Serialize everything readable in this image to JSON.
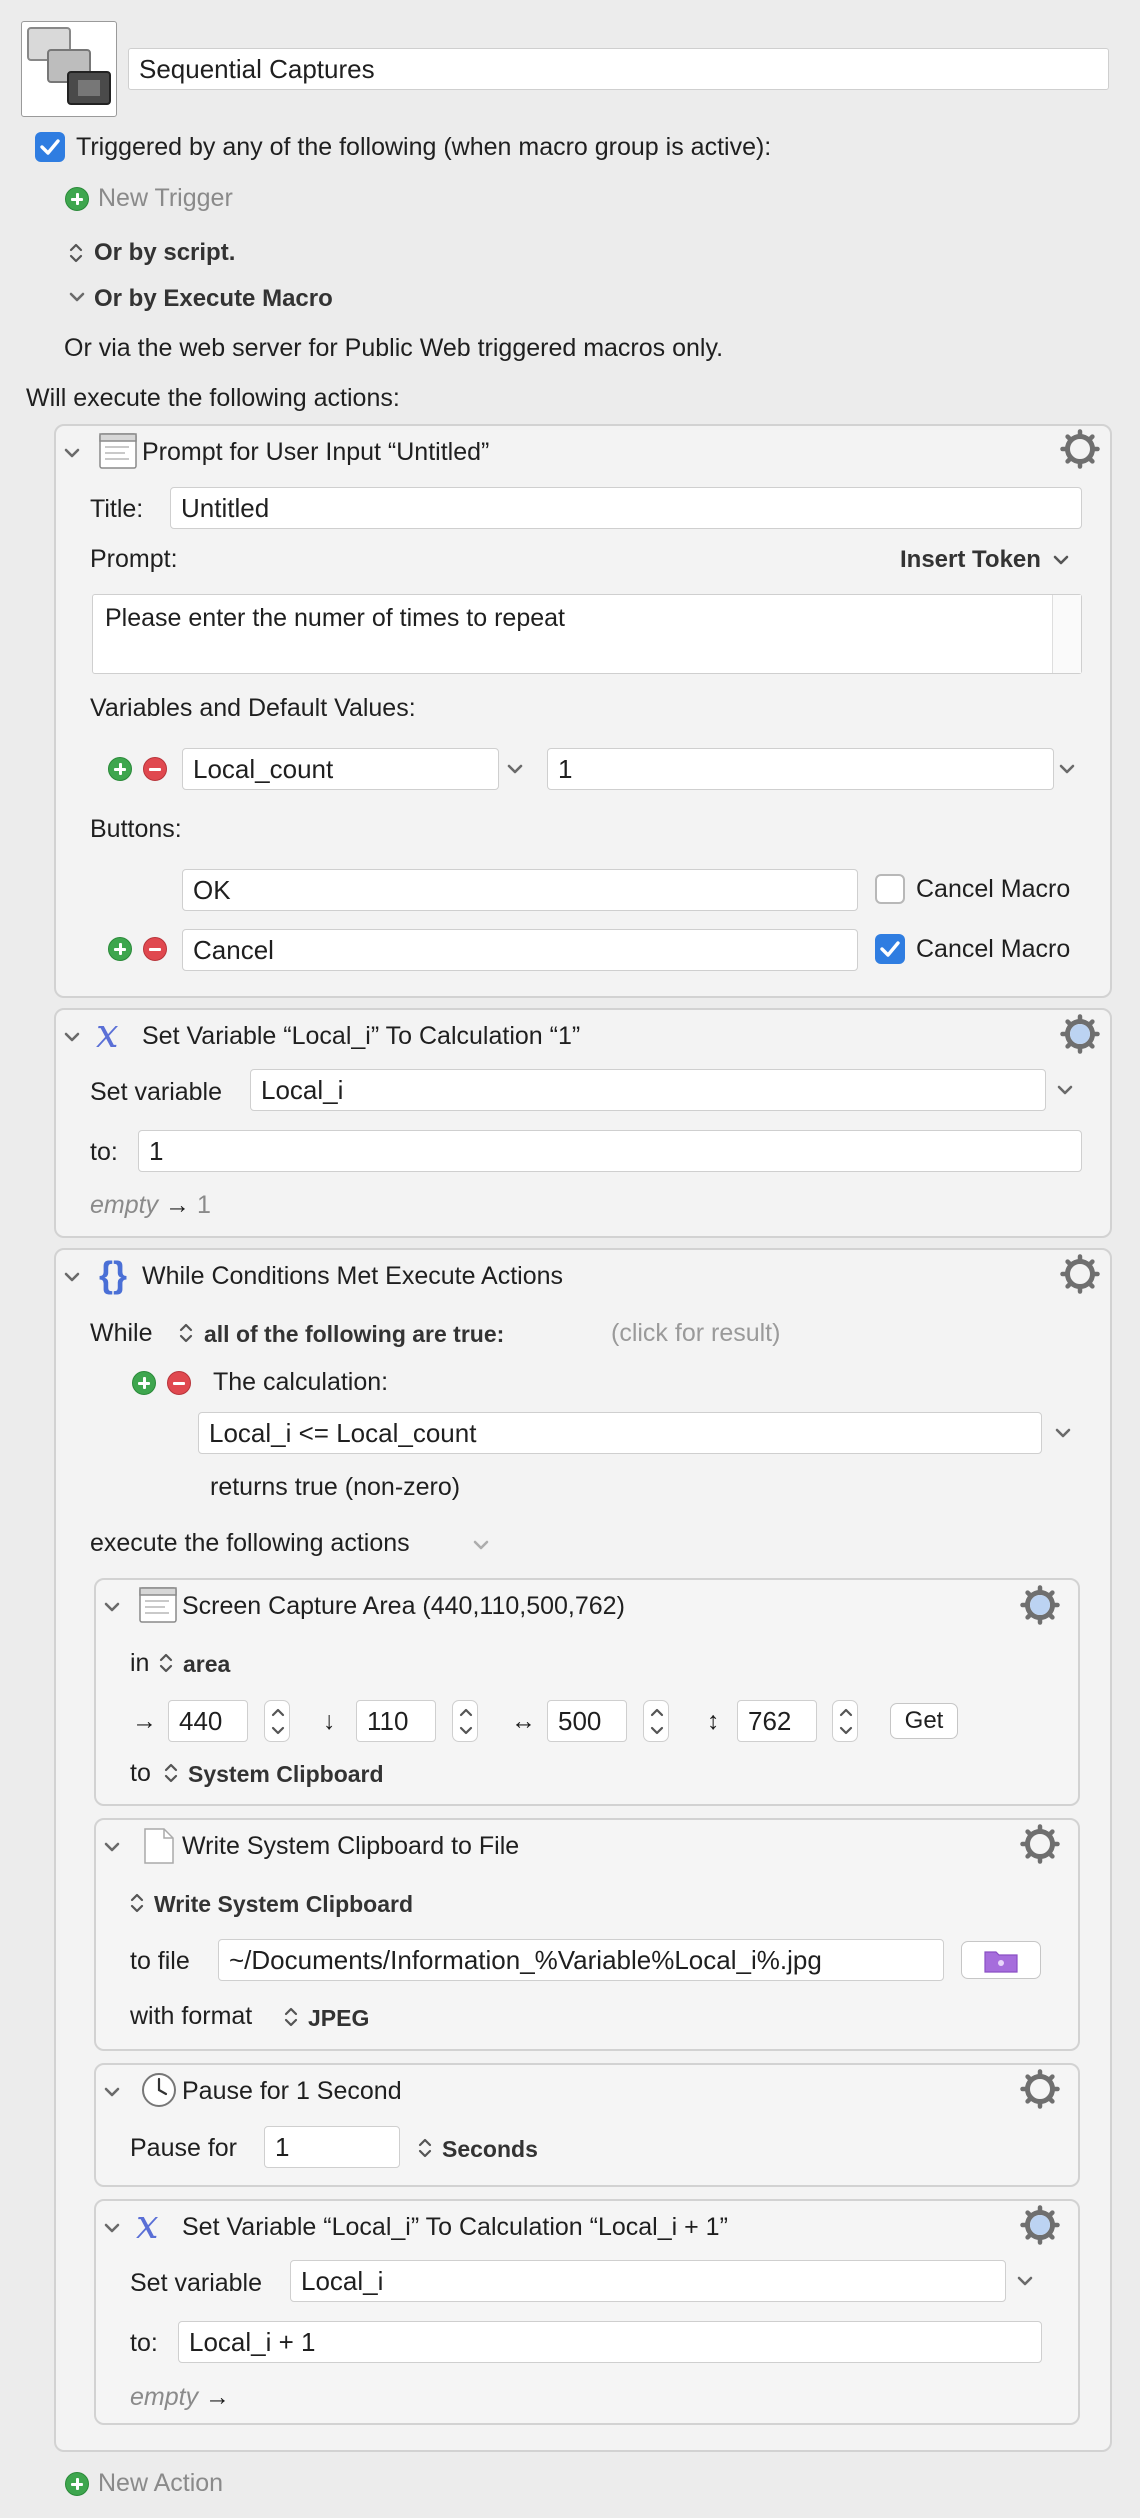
{
  "macro": {
    "name": "Sequential Captures",
    "trigger_label": "Triggered by any of the following (when macro group is active):",
    "new_trigger": "New Trigger",
    "or_by_script": "Or by script.",
    "or_by_execute": "Or by Execute Macro",
    "web_server_note": "Or via the web server for Public Web triggered macros only.",
    "will_execute": "Will execute the following actions:",
    "new_action": "New Action"
  },
  "prompt_action": {
    "title": "Prompt for User Input “Untitled”",
    "title_label": "Title:",
    "title_value": "Untitled",
    "prompt_label": "Prompt:",
    "insert_token": "Insert Token",
    "prompt_text": "Please enter the numer of times to repeat",
    "variables_label": "Variables and Default Values:",
    "variable_name": "Local_count",
    "variable_default": "1",
    "buttons_label": "Buttons:",
    "buttons": [
      {
        "label": "OK",
        "cancel_label": "Cancel Macro",
        "cancel_checked": false
      },
      {
        "label": "Cancel",
        "cancel_label": "Cancel Macro",
        "cancel_checked": true
      }
    ]
  },
  "set_var1": {
    "title": "Set Variable “Local_i” To Calculation “1”",
    "set_label": "Set variable",
    "var_name": "Local_i",
    "to_label": "to:",
    "to_value": "1",
    "preview_empty": "empty",
    "preview_arrow": "→",
    "preview_value": "1"
  },
  "while_action": {
    "title": "While Conditions Met Execute Actions",
    "while_label": "While",
    "condition_mode": "all of the following are true:",
    "click_result": "(click for result)",
    "calc_label": "The calculation:",
    "calc_value": "Local_i <= Local_count",
    "returns_label": "returns true (non-zero)",
    "execute_label": "execute the following actions"
  },
  "capture_action": {
    "title": "Screen Capture Area (440,110,500,762)",
    "in_label": "in",
    "area_label": "area",
    "right_arrow": "→",
    "left": "440",
    "down_arrow": "↓",
    "top": "110",
    "horiz_arrow": "↔",
    "width": "500",
    "vert_arrow": "↕",
    "height": "762",
    "get_button": "Get",
    "to_label": "to",
    "destination": "System Clipboard"
  },
  "write_action": {
    "title": "Write System Clipboard to File",
    "source": "Write System Clipboard",
    "to_file_label": "to file",
    "file_path": "~/Documents/Information_%Variable%Local_i%.jpg",
    "format_label": "with format",
    "format_value": "JPEG"
  },
  "pause_action": {
    "title": "Pause for 1 Second",
    "pause_label": "Pause for",
    "pause_value": "1",
    "unit": "Seconds"
  },
  "set_var2": {
    "title": "Set Variable “Local_i” To Calculation “Local_i + 1”",
    "set_label": "Set variable",
    "var_name": "Local_i",
    "to_label": "to:",
    "to_value": "Local_i + 1",
    "preview_empty": "empty",
    "preview_arrow": "→"
  },
  "colors": {
    "accent": "#2f7de1",
    "add_green": "#3ea64e",
    "remove_red": "#e0484f",
    "variable_x": "#5a6fd6"
  }
}
